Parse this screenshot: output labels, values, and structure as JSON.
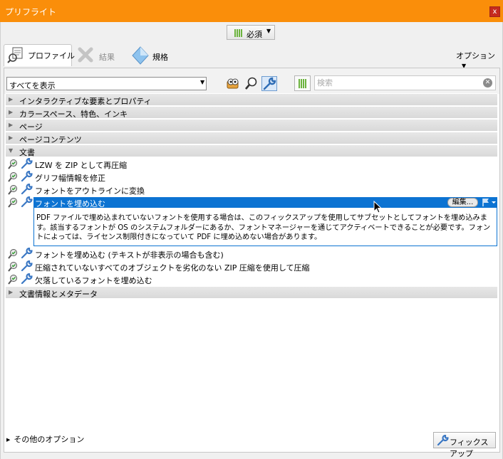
{
  "window": {
    "title": "プリフライト",
    "close_label": "x"
  },
  "top_selector": {
    "label": "必須"
  },
  "tabs": [
    {
      "label": "プロファイル"
    },
    {
      "label": "結果"
    },
    {
      "label": "規格"
    }
  ],
  "options_label": "オプション",
  "toolbar": {
    "filter_value": "すべてを表示",
    "search_placeholder": "検索"
  },
  "categories_top": [
    {
      "label": "インタラクティブな要素とプロパティ"
    },
    {
      "label": "カラースペース、特色、インキ"
    },
    {
      "label": "ページ"
    },
    {
      "label": "ページコンテンツ"
    }
  ],
  "expanded_category": {
    "label": "文書"
  },
  "items_before": [
    {
      "label": "LZW を ZIP として再圧縮"
    },
    {
      "label": "グリフ幅情報を修正"
    },
    {
      "label": "フォントをアウトラインに変換"
    }
  ],
  "selected_item": {
    "label": "フォントを埋め込む",
    "edit_label": "編集...",
    "description": "PDF ファイルで埋め込まれていないフォントを使用する場合は、このフィックスアップを使用してサブセットとしてフォントを埋め込みます。該当するフォントが OS のシステムフォルダーにあるか、フォントマネージャーを通じてアクティベートできることが必要です。フォントによっては、ライセンス制限付きになっていて PDF に埋め込めない場合があります。"
  },
  "items_after": [
    {
      "label": "フォントを埋め込む (テキストが非表示の場合も含む)"
    },
    {
      "label": "圧縮されていないすべてのオブジェクトを劣化のない ZIP 圧縮を使用して圧縮"
    },
    {
      "label": "欠落しているフォントを埋め込む"
    }
  ],
  "categories_bottom": [
    {
      "label": "文書情報とメタデータ"
    }
  ],
  "footer": {
    "more_options": "その他のオプション",
    "fixup_button": "フィックスアップ"
  },
  "colors": {
    "titlebar": "#fa8e0a",
    "selection": "#0c73d2",
    "wrench_blue": "#3b78c4",
    "bars_green": "#6cb33e"
  }
}
